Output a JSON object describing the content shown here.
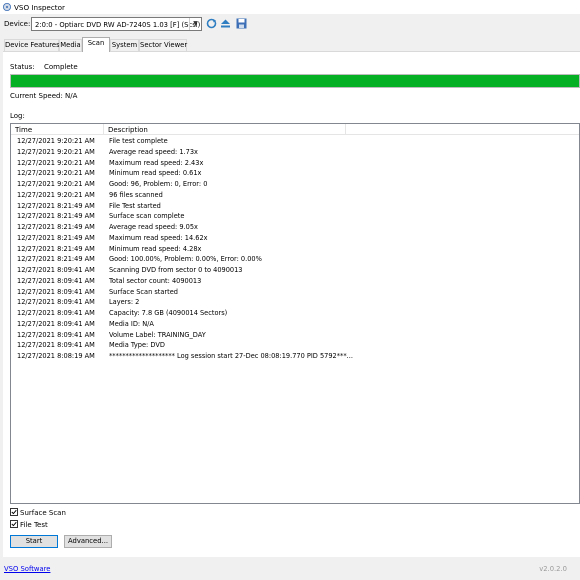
{
  "window": {
    "title": "VSO Inspector"
  },
  "device": {
    "label": "Device:",
    "selected": "2:0:0 - Optiarc DVD RW AD-7240S 1.03 [F] (Scsi)",
    "icons": [
      "refresh-icon",
      "eject-icon",
      "save-icon"
    ]
  },
  "tabs": [
    {
      "label": "Device Features",
      "active": false
    },
    {
      "label": "Media",
      "active": false
    },
    {
      "label": "Scan",
      "active": true
    },
    {
      "label": "System",
      "active": false
    },
    {
      "label": "Sector Viewer",
      "active": false
    }
  ],
  "scan": {
    "status_label": "Status:",
    "status_value": "Complete",
    "progress_percent": 100,
    "current_speed": "Current Speed: N/A",
    "log_label": "Log:",
    "columns": {
      "time": "Time",
      "description": "Description"
    },
    "rows": [
      {
        "time": "12/27/2021 9:20:21 AM",
        "desc": "File test complete"
      },
      {
        "time": "12/27/2021 9:20:21 AM",
        "desc": "Average read speed: 1.73x"
      },
      {
        "time": "12/27/2021 9:20:21 AM",
        "desc": "Maximum read speed: 2.43x"
      },
      {
        "time": "12/27/2021 9:20:21 AM",
        "desc": "Minimum read speed: 0.61x"
      },
      {
        "time": "12/27/2021 9:20:21 AM",
        "desc": "Good: 96, Problem: 0, Error: 0"
      },
      {
        "time": "12/27/2021 9:20:21 AM",
        "desc": "96 files scanned"
      },
      {
        "time": "12/27/2021 8:21:49 AM",
        "desc": "File Test started"
      },
      {
        "time": "12/27/2021 8:21:49 AM",
        "desc": "Surface scan complete"
      },
      {
        "time": "12/27/2021 8:21:49 AM",
        "desc": "Average read speed: 9.05x"
      },
      {
        "time": "12/27/2021 8:21:49 AM",
        "desc": "Maximum read speed: 14.62x"
      },
      {
        "time": "12/27/2021 8:21:49 AM",
        "desc": "Minimum read speed: 4.28x"
      },
      {
        "time": "12/27/2021 8:21:49 AM",
        "desc": "Good: 100.00%, Problem: 0.00%, Error: 0.00%"
      },
      {
        "time": "12/27/2021 8:09:41 AM",
        "desc": "Scanning DVD from sector 0 to 4090013"
      },
      {
        "time": "12/27/2021 8:09:41 AM",
        "desc": "Total sector count: 4090013"
      },
      {
        "time": "12/27/2021 8:09:41 AM",
        "desc": "Surface Scan started"
      },
      {
        "time": "12/27/2021 8:09:41 AM",
        "desc": "Layers: 2"
      },
      {
        "time": "12/27/2021 8:09:41 AM",
        "desc": "Capacity: 7.8 GB (4090014 Sectors)"
      },
      {
        "time": "12/27/2021 8:09:41 AM",
        "desc": "Media ID: N/A"
      },
      {
        "time": "12/27/2021 8:09:41 AM",
        "desc": "Volume Label: TRAINING_DAY"
      },
      {
        "time": "12/27/2021 8:09:41 AM",
        "desc": "Media Type: DVD"
      },
      {
        "time": "12/27/2021 8:08:19 AM",
        "desc": "******************** Log session start 27-Dec 08:08:19.770 PID 5792***..."
      }
    ],
    "options": [
      {
        "label": "Surface Scan",
        "checked": true
      },
      {
        "label": "File Test",
        "checked": true
      }
    ],
    "start_label": "Start",
    "advanced_label": "Advanced..."
  },
  "footer": {
    "link": "VSO Software",
    "version": "v2.0.2.0"
  },
  "colors": {
    "progress": "#06b025",
    "link": "#0000ee",
    "accent": "#0078d7"
  }
}
